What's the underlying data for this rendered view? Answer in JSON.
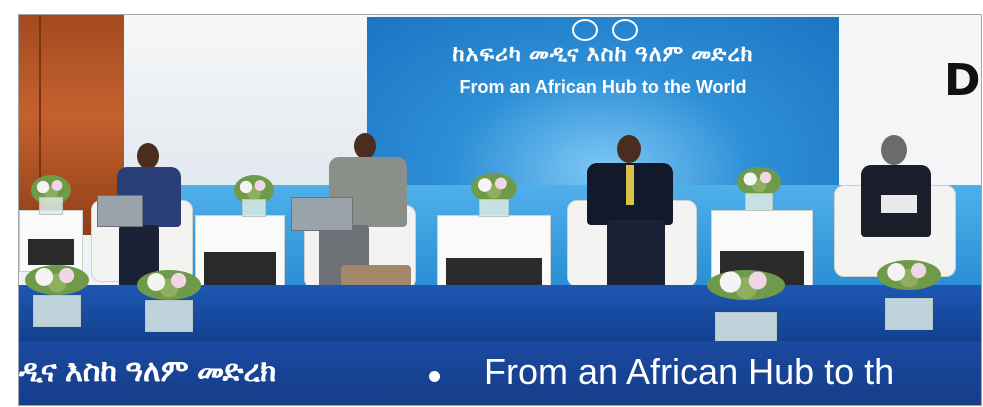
{
  "banner": {
    "amharic_text": "ከአፍሪካ መዲና እስከ ዓለም መድረክ",
    "english_text": "From an African Hub to the World"
  },
  "stage_front": {
    "amharic_text": "ዲና እስከ ዓለም መድረክ",
    "english_text": "From an African Hub to th"
  },
  "corner_brand": "Di",
  "colors": {
    "banner_blue": "#2d8fd6",
    "stage_blue": "#1b4aa2",
    "wall_orange": "#c4612e"
  }
}
